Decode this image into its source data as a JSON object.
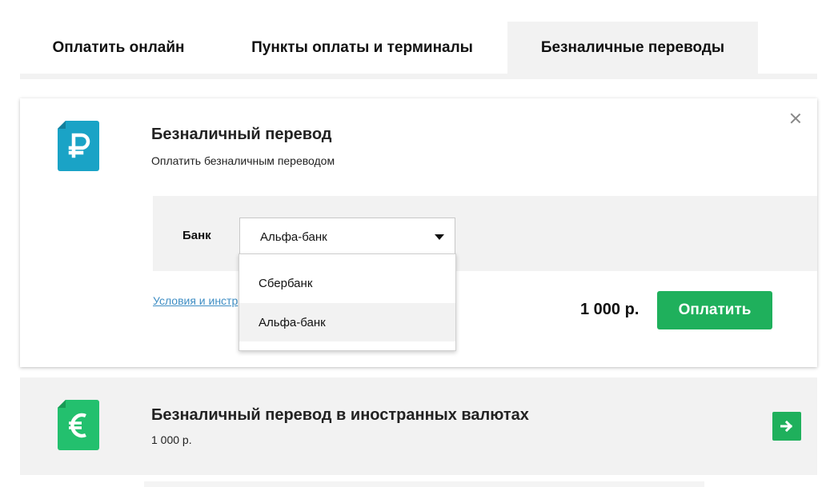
{
  "tabs": [
    {
      "label": "Оплатить онлайн",
      "active": false
    },
    {
      "label": "Пункты оплаты и терминалы",
      "active": false
    },
    {
      "label": "Безналичные переводы",
      "active": true
    }
  ],
  "transfer_card": {
    "icon": "ruble-document-icon",
    "icon_glyph": "₽",
    "icon_color": "#1aa3c6",
    "title": "Безналичный перевод",
    "subtitle": "Оплатить безналичным переводом",
    "bank_label": "Банк",
    "bank_selected": "Альфа-банк",
    "terms_link": "Условия и инстр",
    "price": "1 000 р.",
    "pay_button": "Оплатить"
  },
  "bank_dropdown": {
    "options": [
      "Сбербанк",
      "Альфа-банк"
    ],
    "highlighted": "Альфа-банк"
  },
  "foreign_card": {
    "icon": "euro-document-icon",
    "icon_glyph": "€",
    "icon_color": "#23c06e",
    "title": "Безналичный перевод в иностранных валютах",
    "price": "1 000 р."
  },
  "colors": {
    "accent_green": "#1fb05c",
    "link_blue": "#3f8ec4",
    "panel_gray": "#f2f2f2"
  }
}
